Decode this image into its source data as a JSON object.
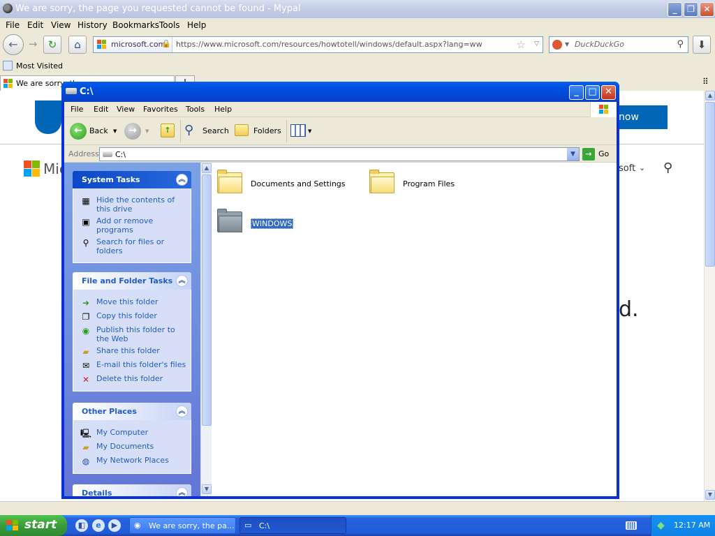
{
  "browser": {
    "title": "We are sorry, the page you requested cannot be found - Mypal",
    "menu": [
      "File",
      "Edit",
      "View",
      "History",
      "Bookmarks",
      "Tools",
      "Help"
    ],
    "site_identity": "microsoft.com",
    "url": "https://www.microsoft.com/resources/howtotell/windows/default.aspx?lang=ww",
    "search_placeholder": "DuckDuckGo",
    "bookmarks": [
      "Most Visited"
    ],
    "tab_title": "We are sorry, th",
    "page_fragments": {
      "nav_label": "soft",
      "partial_button": "now",
      "partial_word": "d.",
      "logo_text": "Mic"
    }
  },
  "explorer": {
    "title": "C:\\",
    "menu": [
      "File",
      "Edit",
      "View",
      "Favorites",
      "Tools",
      "Help"
    ],
    "toolbar": {
      "back": "Back",
      "search": "Search",
      "folders": "Folders"
    },
    "address_label": "Address",
    "address_value": "C:\\",
    "go_label": "Go",
    "panels": {
      "system_tasks": {
        "title": "System Tasks",
        "items": [
          "Hide the contents of this drive",
          "Add or remove programs",
          "Search for files or folders"
        ]
      },
      "file_folder_tasks": {
        "title": "File and Folder Tasks",
        "items": [
          "Move this folder",
          "Copy this folder",
          "Publish this folder to the Web",
          "Share this folder",
          "E-mail this folder's files",
          "Delete this folder"
        ]
      },
      "other_places": {
        "title": "Other Places",
        "items": [
          "My Computer",
          "My Documents",
          "My Network Places"
        ]
      },
      "details": {
        "title": "Details"
      }
    },
    "folders": [
      "Documents and Settings",
      "Program Files",
      "WINDOWS"
    ],
    "selected_folder": "WINDOWS"
  },
  "taskbar": {
    "start_label": "start",
    "tasks": [
      "We are sorry, the pa...",
      "C:\\"
    ],
    "clock": "12:17 AM"
  }
}
